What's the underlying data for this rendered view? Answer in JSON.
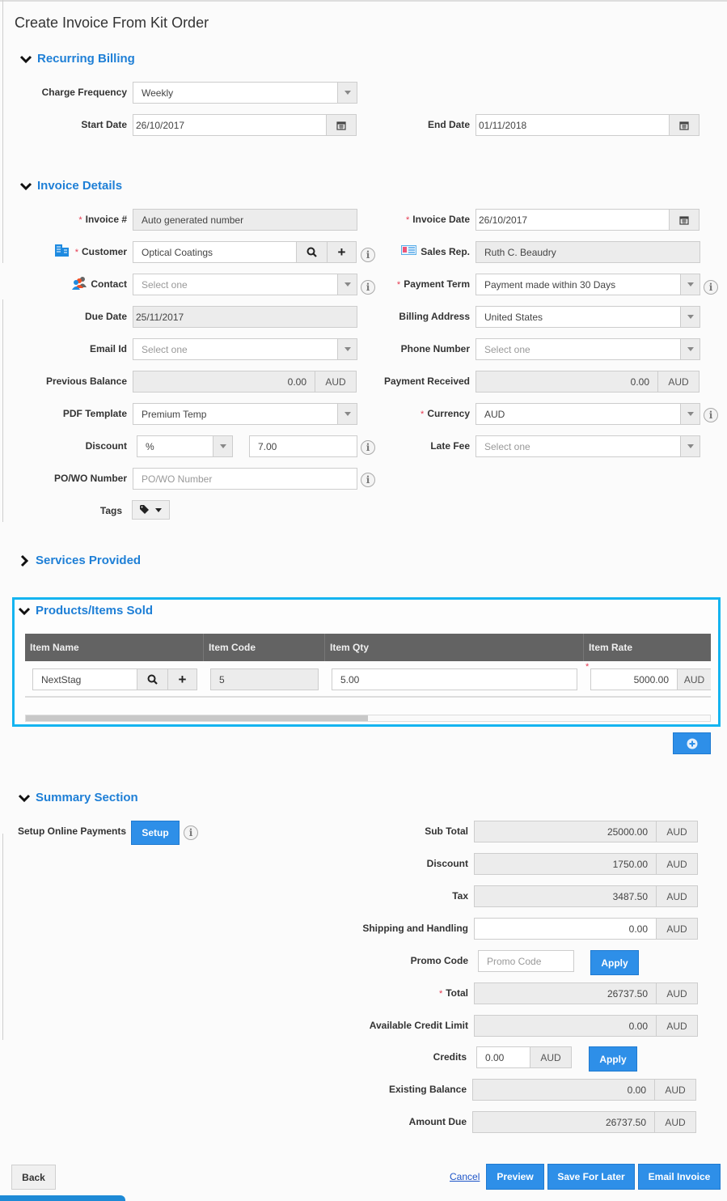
{
  "page": {
    "title": "Create Invoice From Kit Order"
  },
  "recurring": {
    "heading": "Recurring Billing",
    "charge_frequency": {
      "label": "Charge Frequency",
      "value": "Weekly"
    },
    "start_date": {
      "label": "Start Date",
      "value": "26/10/2017"
    },
    "end_date": {
      "label": "End Date",
      "value": "01/11/2018"
    }
  },
  "invoice": {
    "heading": "Invoice Details",
    "invoice_no": {
      "label": "Invoice #",
      "value": "Auto generated number"
    },
    "invoice_date": {
      "label": "Invoice Date",
      "value": "26/10/2017"
    },
    "customer": {
      "label": "Customer",
      "value": "Optical Coatings"
    },
    "sales_rep": {
      "label": "Sales Rep.",
      "value": "Ruth C. Beaudry"
    },
    "contact": {
      "label": "Contact",
      "placeholder": "Select one"
    },
    "payment_term": {
      "label": "Payment Term",
      "value": "Payment made within 30 Days"
    },
    "due_date": {
      "label": "Due Date",
      "value": "25/11/2017"
    },
    "billing_address": {
      "label": "Billing Address",
      "value": "United States"
    },
    "email_id": {
      "label": "Email Id",
      "placeholder": "Select one"
    },
    "phone_number": {
      "label": "Phone Number",
      "placeholder": "Select one"
    },
    "previous_balance": {
      "label": "Previous Balance",
      "value": "0.00",
      "currency": "AUD"
    },
    "payment_received": {
      "label": "Payment Received",
      "value": "0.00",
      "currency": "AUD"
    },
    "pdf_template": {
      "label": "PDF Template",
      "value": "Premium Temp"
    },
    "currency": {
      "label": "Currency",
      "value": "AUD"
    },
    "discount": {
      "label": "Discount",
      "type": "%",
      "value": "7.00"
    },
    "late_fee": {
      "label": "Late Fee",
      "placeholder": "Select one"
    },
    "po_wo": {
      "label": "PO/WO Number",
      "placeholder": "PO/WO Number"
    },
    "tags": {
      "label": "Tags"
    }
  },
  "services": {
    "heading": "Services Provided"
  },
  "products": {
    "heading": "Products/Items Sold",
    "columns": [
      "Item Name",
      "Item Code",
      "Item Qty",
      "Item Rate"
    ],
    "rows": [
      {
        "name": "NextStag",
        "code": "5",
        "qty": "5.00",
        "rate": "5000.00",
        "currency": "AUD"
      }
    ],
    "scroll_fraction": 0.5
  },
  "summary": {
    "heading": "Summary Section",
    "online_payments_label": "Setup Online Payments",
    "setup_button": "Setup",
    "sub_total": {
      "label": "Sub Total",
      "value": "25000.00",
      "currency": "AUD"
    },
    "discount": {
      "label": "Discount",
      "value": "1750.00",
      "currency": "AUD"
    },
    "tax": {
      "label": "Tax",
      "value": "3487.50",
      "currency": "AUD"
    },
    "shipping": {
      "label": "Shipping and Handling",
      "value": "0.00",
      "currency": "AUD"
    },
    "promo": {
      "label": "Promo Code",
      "placeholder": "Promo Code",
      "apply": "Apply"
    },
    "total": {
      "label": "Total",
      "value": "26737.50",
      "currency": "AUD"
    },
    "credit_limit": {
      "label": "Available Credit Limit",
      "value": "0.00",
      "currency": "AUD"
    },
    "credits": {
      "label": "Credits",
      "value": "0.00",
      "currency": "AUD",
      "apply": "Apply"
    },
    "existing_balance": {
      "label": "Existing Balance",
      "value": "0.00",
      "currency": "AUD"
    },
    "amount_due": {
      "label": "Amount Due",
      "value": "26737.50",
      "currency": "AUD"
    }
  },
  "footer": {
    "back": "Back",
    "cancel": "Cancel",
    "preview": "Preview",
    "save_later": "Save For Later",
    "email_invoice": "Email Invoice"
  },
  "common": {
    "required_mark": "*",
    "info_glyph": "i"
  }
}
